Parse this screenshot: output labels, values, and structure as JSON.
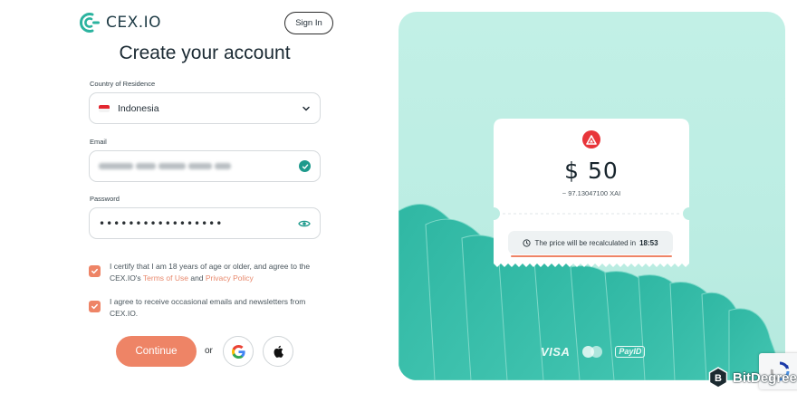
{
  "header": {
    "logo_text": "CEX.IO",
    "signin_label": "Sign In"
  },
  "form": {
    "title": "Create your account",
    "country": {
      "label": "Country of Residence",
      "value": "Indonesia",
      "flag_icon": "indonesia-flag-icon"
    },
    "email": {
      "label": "Email",
      "value_blurred": true,
      "status_icon": "check-circle-icon"
    },
    "password": {
      "label": "Password",
      "value_masked": "•••••••••••••••••",
      "toggle_icon": "eye-icon"
    },
    "consent_terms": {
      "checked": true,
      "text_before": "I certify that I am 18 years of age or older, and agree to the CEX.IO's ",
      "terms_link": "Terms of Use",
      "and_text": " and ",
      "privacy_link": "Privacy Policy"
    },
    "consent_marketing": {
      "checked": true,
      "text": "I agree to receive occasional emails and newsletters from CEX.IO."
    },
    "continue_label": "Continue",
    "or_label": "or",
    "social_buttons": [
      "google-icon",
      "apple-icon"
    ]
  },
  "promo": {
    "token_icon": "arbitrum-triangle-icon",
    "price": "$ 50",
    "price_sub": "~ 97.13047100 XAI",
    "recalc_text": "The price will be recalculated in",
    "recalc_time": "18:53",
    "payment_logos": {
      "visa": "VISA",
      "mastercard": "mastercard-icon",
      "payid": "PayID"
    }
  },
  "watermark": {
    "text": "BitDegree"
  },
  "colors": {
    "accent": "#ee8466",
    "brand_teal": "#1e9a8c",
    "panel_bg": "#c2f0e6",
    "wave": "#3bbfab"
  }
}
